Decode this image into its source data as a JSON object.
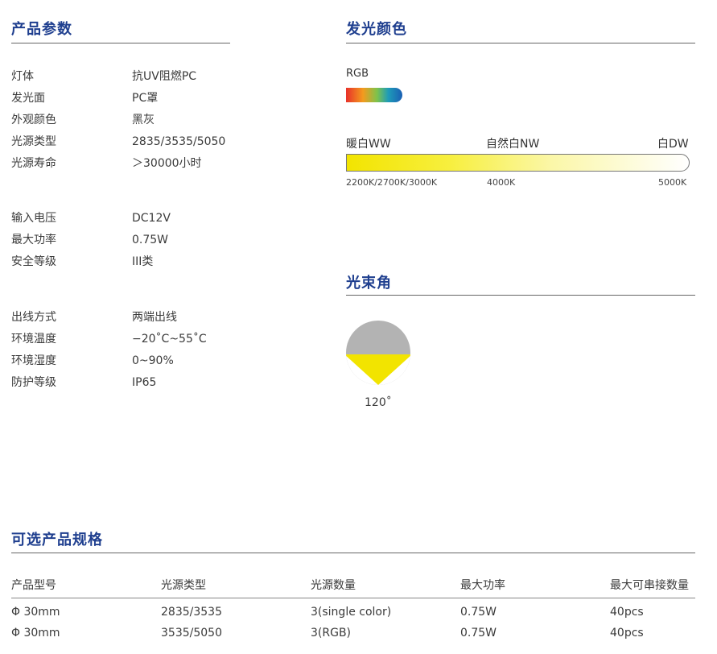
{
  "params": {
    "title": "产品参数",
    "groups": [
      [
        {
          "label": "灯体",
          "value": "抗UV阻燃PC"
        },
        {
          "label": "发光面",
          "value": "PC罩"
        },
        {
          "label": "外观颜色",
          "value": "黑灰"
        },
        {
          "label": "光源类型",
          "value": "2835/3535/5050"
        },
        {
          "label": "光源寿命",
          "value": "＞30000小时"
        }
      ],
      [
        {
          "label": "输入电压",
          "value": "DC12V"
        },
        {
          "label": "最大功率",
          "value": "0.75W"
        },
        {
          "label": "安全等级",
          "value": "III类"
        }
      ],
      [
        {
          "label": "出线方式",
          "value": "两端出线"
        },
        {
          "label": "环境温度",
          "value": "−20˚C~55˚C"
        },
        {
          "label": "环境湿度",
          "value": "0~90%"
        },
        {
          "label": "防护等级",
          "value": "IP65"
        }
      ]
    ]
  },
  "color": {
    "title": "发光颜色",
    "rgb_label": "RGB",
    "ww_label": "暖白WW",
    "nw_label": "自然白NW",
    "dw_label": "白DW",
    "ww_k": "2200K/2700K/3000K",
    "nw_k": "4000K",
    "dw_k": "5000K"
  },
  "beam": {
    "title": "光束角",
    "angle": "120˚"
  },
  "options": {
    "title": "可选产品规格",
    "headers": [
      "产品型号",
      "光源类型",
      "光源数量",
      "最大功率",
      "最大可串接数量"
    ],
    "rows": [
      [
        "Φ 30mm",
        "2835/3535",
        "3(single color)",
        "0.75W",
        "40pcs"
      ],
      [
        "Φ 30mm",
        "3535/5050",
        "3(RGB)",
        "0.75W",
        "40pcs"
      ]
    ]
  },
  "colors": {
    "heading": "#1f3f8f",
    "yellow": "#f2e400",
    "gray": "#b3b3b3"
  }
}
